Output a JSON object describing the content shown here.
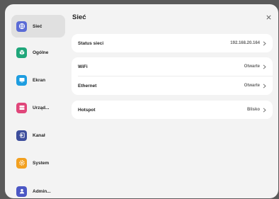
{
  "sidebar": {
    "items": [
      {
        "label": "Sieć",
        "icon": "globe-icon",
        "color": "#5a6bd6",
        "active": true
      },
      {
        "label": "Ogólne",
        "icon": "cube-icon",
        "color": "#1fa67a",
        "active": false
      },
      {
        "label": "Ekran",
        "icon": "display-icon",
        "color": "#1e9de0",
        "active": false
      },
      {
        "label": "Urząd...",
        "icon": "storage-icon",
        "color": "#e0467a",
        "active": false
      },
      {
        "label": "Kanał",
        "icon": "input-icon",
        "color": "#3d4e9c",
        "active": false
      },
      {
        "label": "System",
        "icon": "gear-icon",
        "color": "#f2a020",
        "active": false
      },
      {
        "label": "Admin...",
        "icon": "user-icon",
        "color": "#4b57c4",
        "active": false
      }
    ]
  },
  "main": {
    "title": "Sieć",
    "close_icon": "close-icon",
    "status": {
      "label": "Status sieci",
      "value": "192.168.20.164"
    },
    "wifi": {
      "label": "WiFi",
      "value": "Otwarte"
    },
    "ethernet": {
      "label": "Ethernet",
      "value": "Otwarte"
    },
    "hotspot": {
      "label": "Hotspot",
      "value": "Blisko"
    }
  }
}
